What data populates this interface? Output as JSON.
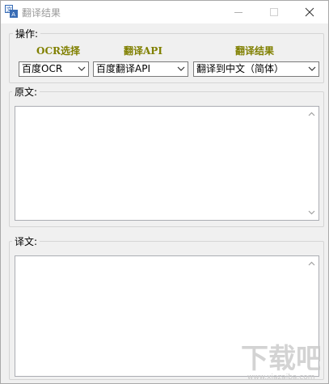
{
  "window": {
    "title": "翻译结果",
    "icons": {
      "app": "translate-app-icon",
      "minimize": "minimize-icon",
      "maximize": "maximize-icon",
      "close": "close-icon"
    }
  },
  "operation": {
    "legend": "操作:",
    "ocr": {
      "label": "OCR选择",
      "value": "百度OCR"
    },
    "translate_api": {
      "label": "翻译API",
      "value": "百度翻译API"
    },
    "result": {
      "label": "翻译结果",
      "value": "翻译到中文（简体）"
    },
    "label_color": "#808000"
  },
  "source": {
    "legend": "原文:",
    "text": ""
  },
  "target": {
    "legend": "译文:",
    "text": ""
  },
  "watermark": {
    "text": "下载吧"
  }
}
